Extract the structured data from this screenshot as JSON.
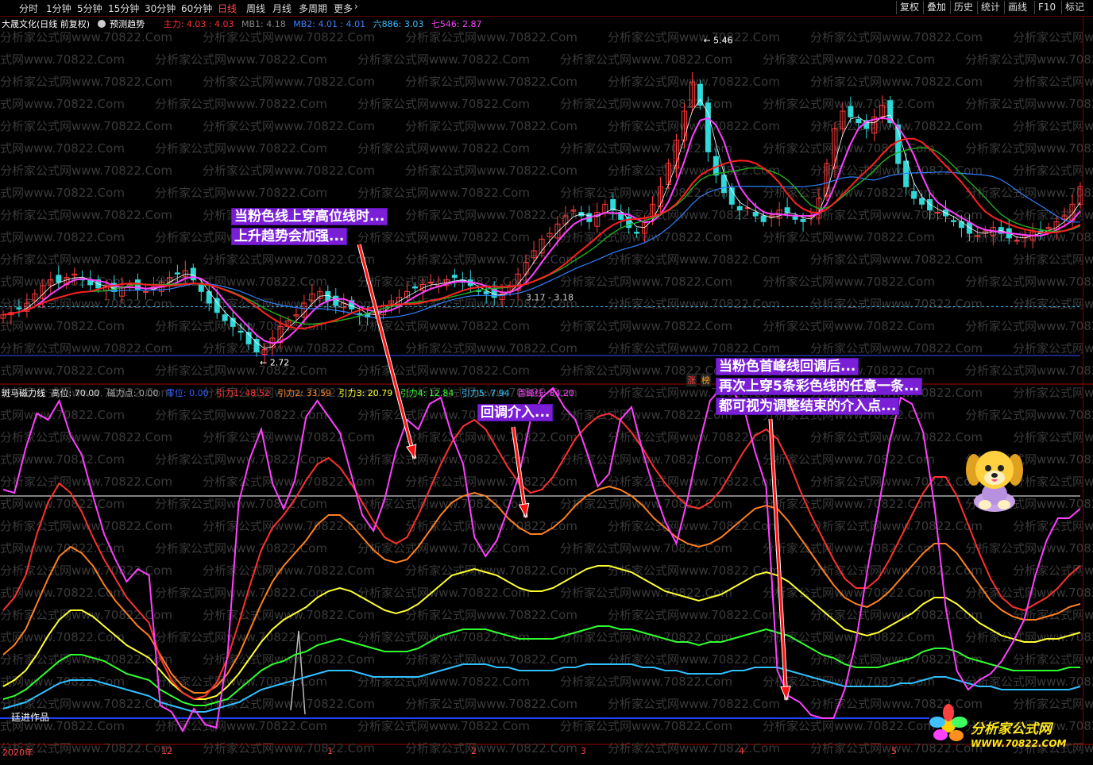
{
  "toolbar": {
    "tabs": [
      "分时",
      "1分钟",
      "5分钟",
      "15分钟",
      "30分钟",
      "60分钟",
      "日线",
      "周线",
      "月线",
      "多周期",
      "更多"
    ],
    "active_tab": "日线",
    "right_buttons": [
      "复权",
      "叠加",
      "历史",
      "统计",
      "画线",
      "F10",
      "标记"
    ]
  },
  "top_legend": {
    "stock": "大晟文化(日线 前复权)",
    "predict": "预测趋势",
    "items": [
      {
        "text": "主力: 4.03 : 4.03",
        "color": "#ff3030"
      },
      {
        "text": "MB1: 4.18",
        "color": "#888888"
      },
      {
        "text": "MB2: 4.01 : 4.01",
        "color": "#4080ff"
      },
      {
        "text": "六886: 3.03",
        "color": "#40c0ff"
      },
      {
        "text": "七546: 2.87",
        "color": "#ff40ff"
      }
    ]
  },
  "bottom_legend": {
    "name": "斑马磁力线",
    "items": [
      {
        "text": "高位: 70.00",
        "color": "#dddddd"
      },
      {
        "text": "磁力点: 0.00",
        "color": "#aaaaaa"
      },
      {
        "text": "零位: 0.00",
        "color": "#3060ff"
      },
      {
        "text": "引力1: 48.52",
        "color": "#ff3030"
      },
      {
        "text": "引力2: 33.59",
        "color": "#ff8020"
      },
      {
        "text": "引力3: 20.79",
        "color": "#ffff30"
      },
      {
        "text": "引力4: 12.84",
        "color": "#30ff30"
      },
      {
        "text": "引力5: 7.94",
        "color": "#30c0ff"
      },
      {
        "text": "首峰线: 84.20",
        "color": "#ff40ff"
      }
    ]
  },
  "price_labels": {
    "high": "5.46",
    "low": "2.72",
    "range": "3.17 - 3.18"
  },
  "badges": {
    "zhang": "涨",
    "bang": "榜"
  },
  "annotations": {
    "a1": [
      "当粉色线上穿高位线时...",
      "上升趋势会加强..."
    ],
    "a2": [
      "回调介入..."
    ],
    "a3": [
      "当粉色首峰线回调后...",
      "再次上穿5条彩色线的任意一条...",
      "都可视为调整结束的介入点..."
    ]
  },
  "x_labels": [
    "2020年",
    "12",
    "1",
    "2",
    "3",
    "4",
    "5"
  ],
  "author": "廷进作品",
  "watermark": "分析家公式网www.70822.Com",
  "logo": {
    "text": "分析家公式网",
    "url": "WWW.70822.COM"
  },
  "chart_data": [
    {
      "type": "candlestick",
      "title": "大晟文化(日线 前复权)",
      "ylim": [
        2.6,
        5.6
      ],
      "annotated_high": 5.46,
      "annotated_low": 2.72,
      "reference_line": 3.17,
      "close": [
        3.1,
        3.12,
        3.15,
        3.2,
        3.28,
        3.35,
        3.4,
        3.38,
        3.42,
        3.45,
        3.4,
        3.36,
        3.33,
        3.35,
        3.3,
        3.34,
        3.36,
        3.32,
        3.3,
        3.34,
        3.38,
        3.42,
        3.45,
        3.48,
        3.4,
        3.3,
        3.2,
        3.12,
        3.05,
        3.0,
        2.95,
        2.85,
        2.78,
        2.8,
        2.9,
        3.0,
        3.05,
        3.1,
        3.2,
        3.28,
        3.3,
        3.22,
        3.18,
        3.2,
        3.15,
        3.1,
        3.08,
        3.12,
        3.18,
        3.22,
        3.25,
        3.3,
        3.33,
        3.36,
        3.38,
        3.35,
        3.4,
        3.42,
        3.38,
        3.35,
        3.3,
        3.28,
        3.25,
        3.28,
        3.35,
        3.45,
        3.55,
        3.65,
        3.75,
        3.8,
        3.88,
        3.95,
        4.0,
        3.95,
        3.9,
        3.98,
        4.05,
        4.0,
        3.92,
        3.85,
        3.8,
        3.9,
        4.05,
        4.2,
        4.4,
        4.6,
        4.85,
        5.1,
        4.9,
        4.5,
        4.3,
        4.15,
        4.05,
        4.0,
        4.02,
        3.95,
        3.9,
        3.95,
        4.0,
        3.98,
        3.92,
        3.9,
        3.95,
        4.1,
        4.4,
        4.7,
        4.85,
        4.8,
        4.75,
        4.7,
        4.8,
        4.9,
        4.75,
        4.4,
        4.2,
        4.1,
        4.05,
        4.0,
        3.98,
        3.95,
        3.9,
        3.85,
        3.8,
        3.78,
        3.82,
        3.85,
        3.8,
        3.76,
        3.74,
        3.78,
        3.82,
        3.8,
        3.85,
        3.9,
        3.95,
        4.05,
        4.2
      ]
    },
    {
      "type": "line",
      "title": "斑马磁力线",
      "ylim": [
        0,
        100
      ],
      "reference_lines": {
        "高位": 70,
        "零位": 0
      },
      "series": [
        {
          "name": "首峰线",
          "color": "#ff40ff",
          "values": [
            72,
            71,
            85,
            96,
            94,
            100,
            89,
            83,
            70,
            58,
            50,
            43,
            47,
            45,
            4,
            2,
            -4,
            3,
            -2,
            -3,
            20,
            68,
            82,
            91,
            74,
            66,
            75,
            95,
            100,
            95,
            90,
            77,
            64,
            59,
            69,
            84,
            94,
            91,
            99,
            101,
            89,
            80,
            57,
            51,
            56,
            66,
            77,
            94,
            101,
            104,
            98,
            94,
            84,
            73,
            77,
            94,
            98,
            84,
            72,
            62,
            55,
            69,
            86,
            100,
            104,
            103,
            98,
            84,
            73,
            15,
            7,
            5,
            1,
            0,
            0,
            9,
            24,
            46,
            66,
            87,
            101,
            99,
            90,
            67,
            35,
            15,
            9,
            12,
            14,
            18,
            24,
            31,
            45,
            56,
            63,
            63,
            66
          ]
        },
        {
          "name": "引力1",
          "color": "#ff3030",
          "values": [
            34,
            38,
            45,
            58,
            68,
            74,
            71,
            65,
            57,
            50,
            44,
            38,
            34,
            30,
            19,
            12,
            8,
            6,
            7,
            11,
            19,
            30,
            42,
            53,
            60,
            64,
            69,
            75,
            80,
            82,
            79,
            74,
            68,
            62,
            57,
            55,
            57,
            64,
            72,
            80,
            87,
            92,
            94,
            91,
            85,
            79,
            74,
            71,
            72,
            76,
            82,
            88,
            92,
            95,
            96,
            94,
            90,
            85,
            79,
            74,
            70,
            67,
            66,
            68,
            72,
            78,
            84,
            89,
            91,
            88,
            81,
            72,
            64,
            57,
            50,
            44,
            41,
            41,
            44,
            50,
            57,
            64,
            71,
            76,
            76,
            70,
            61,
            52,
            44,
            38,
            35,
            34,
            36,
            38,
            41,
            45,
            48
          ]
        },
        {
          "name": "引力2",
          "color": "#ff8020",
          "values": [
            20,
            23,
            28,
            36,
            44,
            51,
            54,
            52,
            48,
            42,
            37,
            33,
            29,
            26,
            20,
            14,
            10,
            8,
            8,
            10,
            14,
            20,
            28,
            36,
            43,
            48,
            52,
            56,
            61,
            64,
            64,
            61,
            57,
            53,
            50,
            49,
            50,
            54,
            59,
            64,
            68,
            70,
            71,
            70,
            67,
            63,
            60,
            58,
            58,
            60,
            63,
            67,
            70,
            72,
            73,
            72,
            70,
            67,
            63,
            60,
            57,
            55,
            54,
            55,
            57,
            60,
            63,
            66,
            67,
            66,
            62,
            57,
            52,
            47,
            42,
            38,
            36,
            35,
            37,
            40,
            44,
            48,
            52,
            55,
            55,
            52,
            47,
            42,
            37,
            34,
            32,
            31,
            31,
            32,
            33,
            35,
            36
          ]
        },
        {
          "name": "引力3",
          "color": "#ffff30",
          "values": [
            10,
            12,
            15,
            20,
            26,
            31,
            34,
            34,
            32,
            29,
            26,
            23,
            21,
            19,
            15,
            11,
            8,
            6,
            6,
            7,
            10,
            14,
            19,
            24,
            28,
            31,
            33,
            35,
            38,
            40,
            41,
            40,
            38,
            36,
            34,
            33,
            34,
            36,
            39,
            42,
            45,
            46,
            47,
            46,
            45,
            43,
            41,
            40,
            40,
            41,
            43,
            45,
            47,
            48,
            48,
            47,
            46,
            44,
            42,
            40,
            39,
            38,
            37,
            38,
            39,
            41,
            43,
            45,
            46,
            45,
            43,
            40,
            37,
            34,
            31,
            28,
            27,
            26,
            27,
            29,
            31,
            33,
            36,
            38,
            38,
            36,
            33,
            30,
            28,
            26,
            25,
            24,
            24,
            25,
            25,
            26,
            27
          ]
        },
        {
          "name": "引力4",
          "color": "#30ff30",
          "values": [
            6,
            7,
            9,
            12,
            15,
            18,
            20,
            20,
            19,
            18,
            16,
            14,
            13,
            12,
            9,
            7,
            5,
            4,
            4,
            5,
            6,
            9,
            12,
            15,
            17,
            18,
            20,
            21,
            23,
            24,
            25,
            24,
            23,
            22,
            21,
            21,
            21,
            22,
            24,
            26,
            27,
            28,
            28,
            28,
            27,
            26,
            25,
            25,
            25,
            25,
            26,
            27,
            28,
            29,
            29,
            28,
            28,
            27,
            26,
            25,
            24,
            24,
            23,
            24,
            24,
            25,
            26,
            27,
            28,
            27,
            26,
            24,
            22,
            20,
            19,
            17,
            16,
            16,
            16,
            17,
            18,
            19,
            21,
            22,
            22,
            21,
            19,
            18,
            17,
            16,
            15,
            15,
            15,
            15,
            15,
            16,
            16
          ]
        },
        {
          "name": "引力5",
          "color": "#30c0ff",
          "values": [
            3,
            4,
            5,
            7,
            9,
            11,
            12,
            12,
            12,
            11,
            10,
            9,
            8,
            7,
            5,
            4,
            3,
            2,
            2,
            3,
            4,
            5,
            7,
            9,
            10,
            11,
            12,
            13,
            14,
            15,
            15,
            15,
            14,
            13,
            13,
            13,
            13,
            13,
            14,
            15,
            16,
            17,
            17,
            17,
            16,
            16,
            15,
            15,
            15,
            15,
            16,
            16,
            17,
            17,
            17,
            17,
            17,
            16,
            16,
            15,
            15,
            14,
            14,
            14,
            14,
            15,
            15,
            16,
            16,
            16,
            15,
            14,
            13,
            12,
            11,
            10,
            10,
            10,
            10,
            10,
            11,
            11,
            12,
            13,
            13,
            12,
            11,
            10,
            10,
            9,
            9,
            9,
            9,
            9,
            9,
            9,
            10
          ]
        }
      ]
    }
  ]
}
